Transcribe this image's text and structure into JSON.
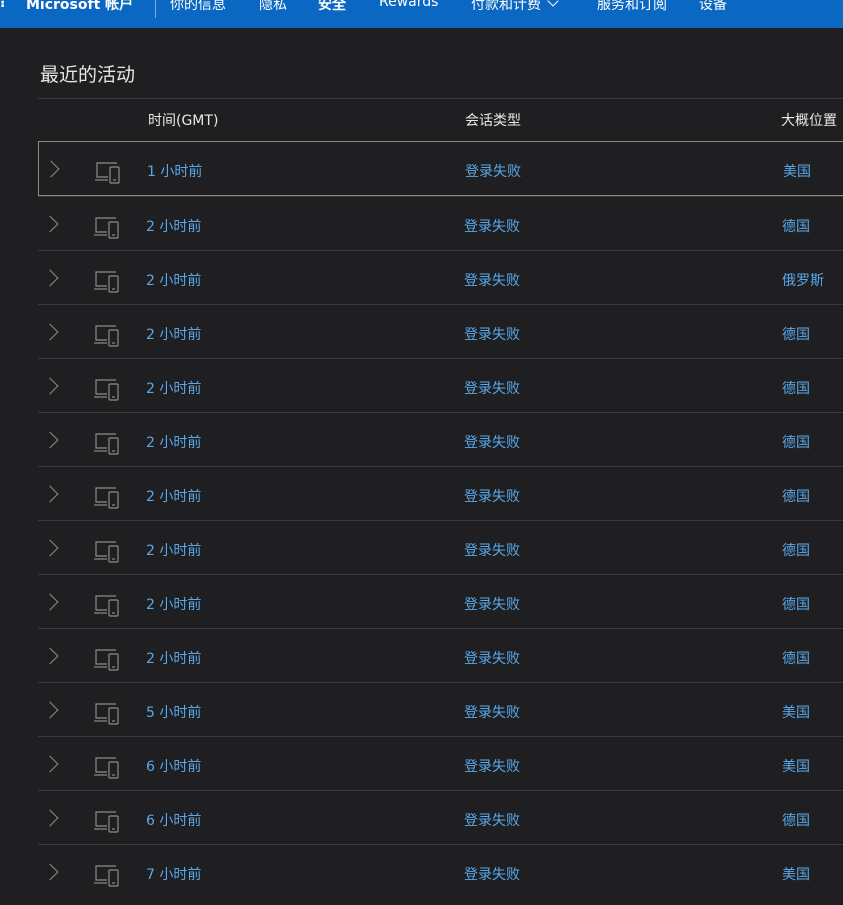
{
  "nav": {
    "brand": "Microsoft 帐户",
    "items": [
      {
        "label": "你的信息"
      },
      {
        "label": "隐私"
      },
      {
        "label": "安全",
        "active": true
      },
      {
        "label": "Rewards"
      },
      {
        "label": "付款和计费",
        "has_dropdown": true
      },
      {
        "label": "服务和订阅"
      },
      {
        "label": "设备"
      }
    ]
  },
  "page": {
    "section_title": "最近的活动"
  },
  "table": {
    "headers": {
      "time": "时间(GMT)",
      "session_type": "会话类型",
      "location": "大概位置"
    },
    "rows": [
      {
        "time": "1 小时前",
        "session_type": "登录失败",
        "location": "美国",
        "selected": true
      },
      {
        "time": "2 小时前",
        "session_type": "登录失败",
        "location": "德国"
      },
      {
        "time": "2 小时前",
        "session_type": "登录失败",
        "location": "俄罗斯"
      },
      {
        "time": "2 小时前",
        "session_type": "登录失败",
        "location": "德国"
      },
      {
        "time": "2 小时前",
        "session_type": "登录失败",
        "location": "德国"
      },
      {
        "time": "2 小时前",
        "session_type": "登录失败",
        "location": "德国"
      },
      {
        "time": "2 小时前",
        "session_type": "登录失败",
        "location": "德国"
      },
      {
        "time": "2 小时前",
        "session_type": "登录失败",
        "location": "德国"
      },
      {
        "time": "2 小时前",
        "session_type": "登录失败",
        "location": "德国"
      },
      {
        "time": "2 小时前",
        "session_type": "登录失败",
        "location": "德国"
      },
      {
        "time": "5 小时前",
        "session_type": "登录失败",
        "location": "美国"
      },
      {
        "time": "6 小时前",
        "session_type": "登录失败",
        "location": "美国"
      },
      {
        "time": "6 小时前",
        "session_type": "登录失败",
        "location": "德国"
      },
      {
        "time": "7 小时前",
        "session_type": "登录失败",
        "location": "美国"
      }
    ]
  },
  "icons": {
    "row_expand": "chevron-right-icon",
    "device": "devices-icon",
    "dropdown": "chevron-down-icon"
  },
  "colors": {
    "nav_background": "#0a67c2",
    "page_background": "#1f1f21",
    "link": "#59a8ea",
    "selected_border": "#8a8f74"
  }
}
